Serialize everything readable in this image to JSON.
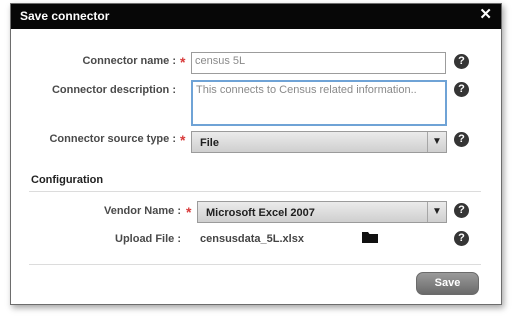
{
  "dialog": {
    "title": "Save connector",
    "close_glyph": "✕"
  },
  "form": {
    "name": {
      "label": "Connector name :",
      "required": "*",
      "value": "census 5L",
      "help": "?"
    },
    "description": {
      "label": "Connector description :",
      "value": "This connects to Census related information..",
      "help": "?"
    },
    "source_type": {
      "label": "Connector source type :",
      "required": "*",
      "value": "File",
      "arrow": "▼",
      "help": "?"
    }
  },
  "configuration": {
    "heading": "Configuration",
    "vendor": {
      "label": "Vendor Name :",
      "required": "*",
      "value": "Microsoft Excel 2007",
      "arrow": "▼",
      "help": "?"
    },
    "upload": {
      "label": "Upload File :",
      "filename": "censusdata_5L.xlsx",
      "icon": "folder-icon",
      "help": "?"
    }
  },
  "footer": {
    "save_label": "Save"
  },
  "colors": {
    "titlebar": "#070707",
    "required": "#d83a3a",
    "focus_border": "#6fa3d6",
    "help_icon": "#353535"
  }
}
